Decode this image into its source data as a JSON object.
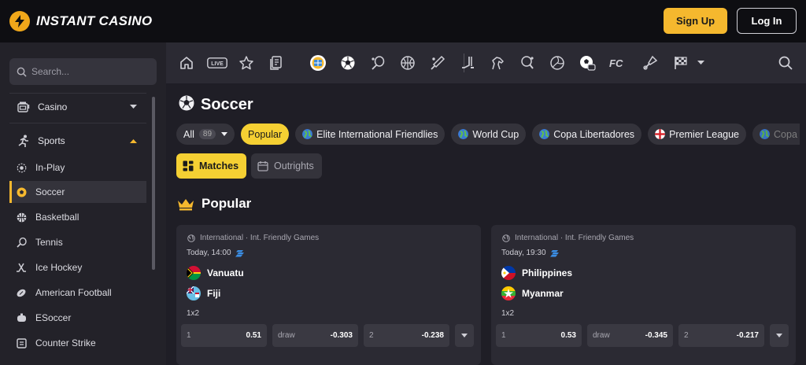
{
  "brand": {
    "name": "INSTANT CASINO"
  },
  "header": {
    "signup_label": "Sign Up",
    "login_label": "Log In"
  },
  "sidebar": {
    "search_placeholder": "Search...",
    "groups": [
      {
        "label": "Casino",
        "icon": "slot-machine-icon",
        "expanded": false
      },
      {
        "label": "Sports",
        "icon": "running-icon",
        "expanded": true
      }
    ],
    "items": [
      {
        "label": "In-Play",
        "icon": "live-dot-icon"
      },
      {
        "label": "Soccer",
        "icon": "soccer-ball-icon",
        "active": true
      },
      {
        "label": "Basketball",
        "icon": "basketball-icon"
      },
      {
        "label": "Tennis",
        "icon": "tennis-racket-icon"
      },
      {
        "label": "Ice Hockey",
        "icon": "hockey-stick-icon"
      },
      {
        "label": "American Football",
        "icon": "american-football-icon"
      },
      {
        "label": "ESoccer",
        "icon": "esoccer-icon"
      },
      {
        "label": "Counter Strike",
        "icon": "counter-strike-icon"
      }
    ]
  },
  "sportbar": {
    "live_label": "LIVE",
    "icons": [
      "home-icon",
      "live-icon",
      "star-icon",
      "betslip-icon",
      "featured-icon",
      "soccer-icon",
      "tennis-icon",
      "basketball-icon",
      "cricket-icon",
      "hockey-icon",
      "horse-racing-icon",
      "table-tennis-icon",
      "volleyball-icon",
      "esoccer-icon",
      "fc-icon",
      "badminton-icon",
      "racing-flag-icon",
      "chevron-down-icon",
      "search-icon"
    ],
    "fc_label": "FC"
  },
  "main": {
    "title": "Soccer",
    "chips": [
      {
        "label": "All",
        "count": "89"
      },
      {
        "label": "Popular"
      },
      {
        "label": "Elite International Friendlies"
      },
      {
        "label": "World Cup"
      },
      {
        "label": "Copa Libertadores"
      },
      {
        "label": "Premier League"
      },
      {
        "label": "Copa"
      }
    ],
    "tabs": [
      {
        "label": "Matches"
      },
      {
        "label": "Outrights"
      }
    ],
    "section_title": "Popular",
    "matches": [
      {
        "league": "International · Int. Friendly Games",
        "time": "Today, 14:00",
        "home": "Vanuatu",
        "away": "Fiji",
        "market": "1x2",
        "odds": [
          {
            "label": "1",
            "value": "0.51"
          },
          {
            "label": "draw",
            "value": "-0.303"
          },
          {
            "label": "2",
            "value": "-0.238"
          }
        ]
      },
      {
        "league": "International · Int. Friendly Games",
        "time": "Today, 19:30",
        "home": "Philippines",
        "away": "Myanmar",
        "market": "1x2",
        "odds": [
          {
            "label": "1",
            "value": "0.53"
          },
          {
            "label": "draw",
            "value": "-0.345"
          },
          {
            "label": "2",
            "value": "-0.217"
          }
        ]
      }
    ]
  },
  "colors": {
    "accent": "#f5b82e",
    "chip_yellow": "#f5d033",
    "background": "#1f1e26",
    "panel": "#2b2a33"
  }
}
